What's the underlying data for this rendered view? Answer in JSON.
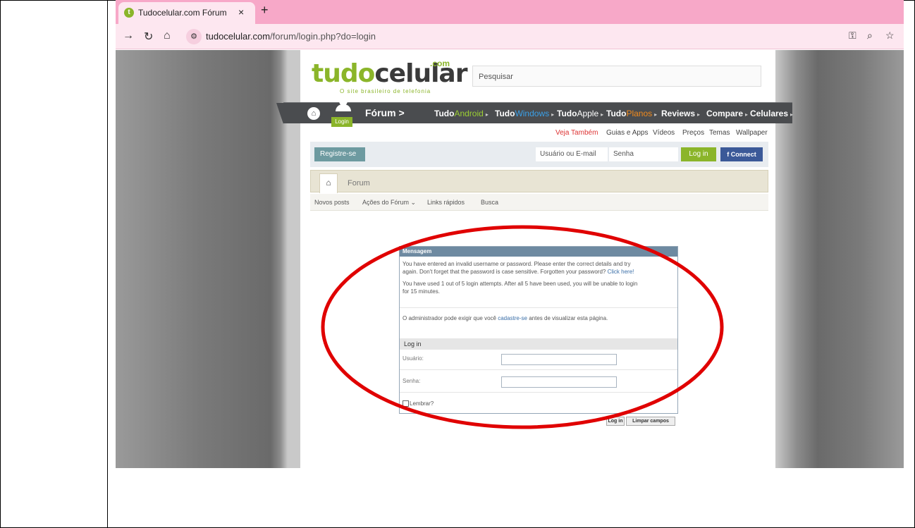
{
  "browser": {
    "tab_title": "Tudocelular.com Fórum",
    "tab_close": "×",
    "new_tab": "+",
    "url_host": "tudocelular.com",
    "url_path": "/forum/login.php?do=login"
  },
  "site": {
    "logo_tudo": "tudo",
    "logo_celular": "celular",
    "logo_com": ".com",
    "logo_slogan": "O site brasileiro de telefonia",
    "search_placeholder": "Pesquisar",
    "nav_login": "Login",
    "nav_forum": "Fórum  >",
    "nav": {
      "tudo1": "Tudo",
      "android": "Android",
      "tudo2": "Tudo",
      "windows": "Windows",
      "tudo3": "Tudo",
      "apple": "Apple",
      "tudo4": "Tudo",
      "planos": "Planos",
      "reviews": "Reviews",
      "compare": "Compare",
      "celulares": "Celulares"
    },
    "subnav": {
      "veja": "Veja Também",
      "guias": "Guias e Apps",
      "videos": "Vídeos",
      "precos": "Preços",
      "temas": "Temas",
      "wallpaper": "Wallpaper"
    },
    "loginstrip": {
      "registre": "Registre-se",
      "usuario": "Usuário ou E-mail",
      "senha": "Senha",
      "login": "Log in",
      "connect": "Connect"
    },
    "crumb_forum": "Forum",
    "actions": {
      "novos": "Novos posts",
      "acoes": "Ações do Fórum",
      "links": "Links rápidos",
      "busca": "Busca"
    }
  },
  "message": {
    "header": "Mensagem",
    "p1a": "You have entered an invalid username or password. Please enter the correct details and try",
    "p1b": "again. Don't forget that the password is case sensitive. Forgotten your password? ",
    "p1_link": "Click here!",
    "p2a": "You have used 1 out of 5 login attempts. After all 5 have been used, you will be unable to login",
    "p2b": "for 15 minutes.",
    "p3a": "O administrador pode exigir que você ",
    "p3_link": "cadastre-se",
    "p3b": " antes de visualizar esta página.",
    "login_header": "Log in",
    "usuario_label": "Usuário:",
    "senha_label": "Senha:",
    "lembrar_label": "Lembrar?",
    "login_button": "Log in",
    "limpar_button": "Limpar campos"
  },
  "colors": {
    "tabstrip": "#f7a8c8",
    "brand_green": "#8bb52a",
    "nav_dark": "#4a4c4f",
    "annotation_red": "#e00000"
  }
}
